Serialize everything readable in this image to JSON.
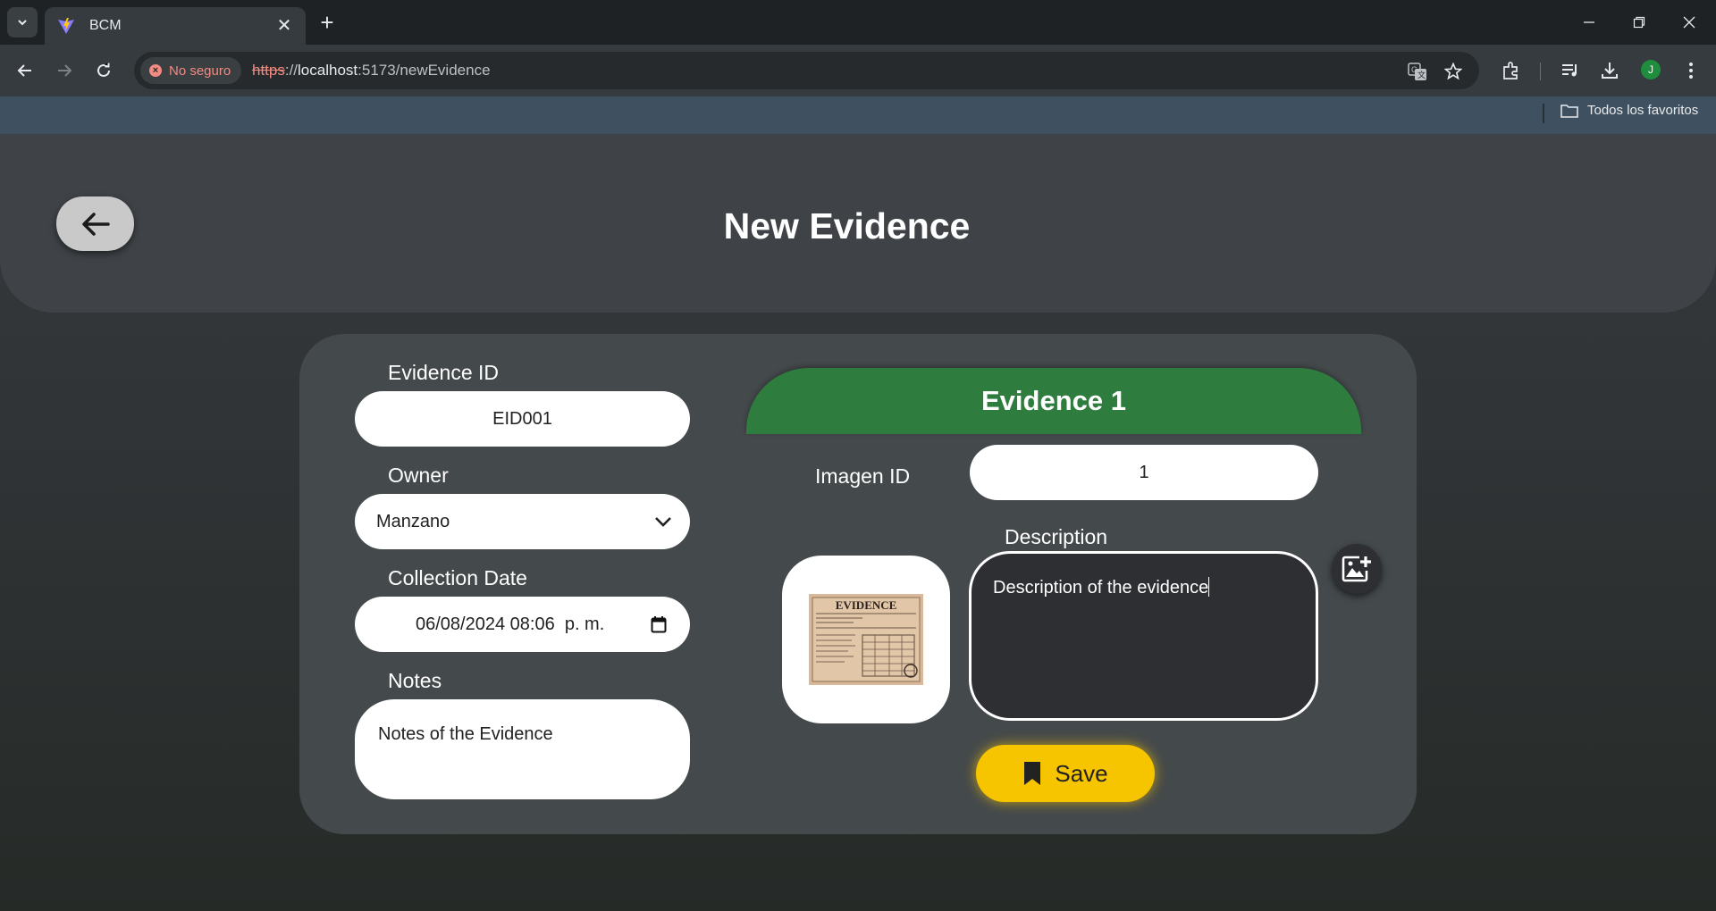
{
  "browser": {
    "tab_title": "BCM",
    "security_label": "No seguro",
    "url_scheme": "https",
    "url_sep": "://",
    "url_host": "localhost",
    "url_rest": ":5173/newEvidence",
    "bookmarks_all_label": "Todos los favoritos",
    "profile_initial": "J"
  },
  "header": {
    "title": "New Evidence"
  },
  "form": {
    "evidence_id_label": "Evidence ID",
    "evidence_id_value": "EID001",
    "owner_label": "Owner",
    "owner_value": "Manzano",
    "collection_date_label": "Collection Date",
    "collection_date_value": "06/08/2024 08:06  p. m.",
    "notes_label": "Notes",
    "notes_value": "Notes of the Evidence"
  },
  "evidence": {
    "title": "Evidence 1",
    "image_id_label": "Imagen ID",
    "image_id_value": "1",
    "description_label": "Description",
    "description_value": "Description of the evidence",
    "thumbnail_caption": "EVIDENCE",
    "save_label": "Save"
  },
  "colors": {
    "banner_green": "#2e7d3e",
    "save_yellow": "#f7c400",
    "card_bg": "#44494b"
  }
}
